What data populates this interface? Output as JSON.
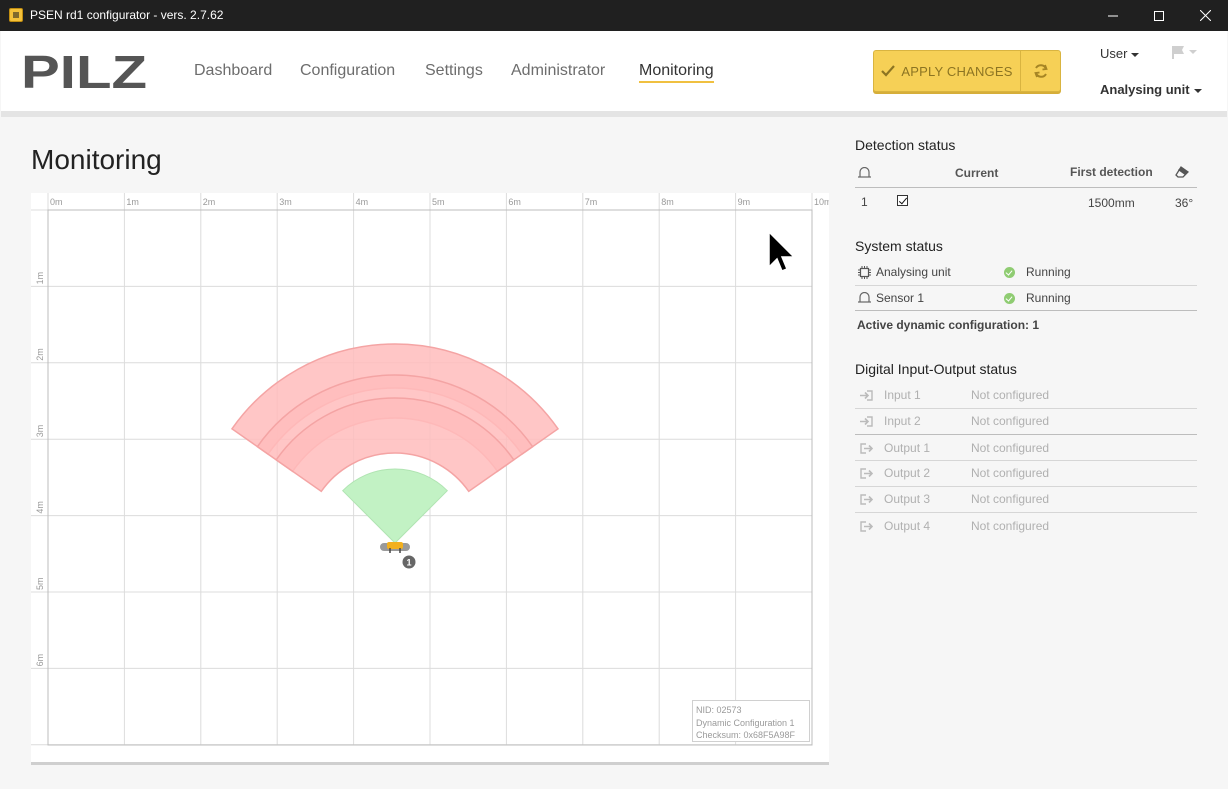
{
  "window": {
    "title": "PSEN rd1 configurator - vers. 2.7.62"
  },
  "header": {
    "logo": "PILZ",
    "nav": [
      {
        "label": "Dashboard"
      },
      {
        "label": "Configuration"
      },
      {
        "label": "Settings"
      },
      {
        "label": "Administrator"
      },
      {
        "label": "Monitoring",
        "active": true
      }
    ],
    "apply_label": "APPLY CHANGES",
    "user_label": "User",
    "unit_label": "Analysing unit"
  },
  "main": {
    "title": "Monitoring",
    "map": {
      "x_ticks": [
        "0m",
        "1m",
        "2m",
        "3m",
        "4m",
        "5m",
        "6m",
        "7m",
        "8m",
        "9m",
        "10m"
      ],
      "y_ticks": [
        "1m",
        "2m",
        "3m",
        "4m",
        "5m",
        "6m"
      ],
      "sensor_badge": "1",
      "info": {
        "nid": "NID: 02573",
        "config": "Dynamic Configuration 1",
        "checksum": "Checksum: 0x68F5A98F"
      }
    }
  },
  "detection": {
    "title": "Detection status",
    "col_current": "Current",
    "col_first": "First detection",
    "rows": [
      {
        "id": "1",
        "current": true,
        "first": "1500mm",
        "angle": "36°"
      }
    ]
  },
  "system": {
    "title": "System status",
    "items": [
      {
        "label": "Analysing unit",
        "status": "Running"
      },
      {
        "label": "Sensor 1",
        "status": "Running"
      }
    ],
    "active_config": "Active dynamic configuration: 1"
  },
  "io": {
    "title": "Digital Input-Output status",
    "items": [
      {
        "label": "Input 1",
        "status": "Not configured",
        "kind": "input"
      },
      {
        "label": "Input 2",
        "status": "Not configured",
        "kind": "input"
      },
      {
        "label": "Output 1",
        "status": "Not configured",
        "kind": "output"
      },
      {
        "label": "Output 2",
        "status": "Not configured",
        "kind": "output"
      },
      {
        "label": "Output 3",
        "status": "Not configured",
        "kind": "output"
      },
      {
        "label": "Output 4",
        "status": "Not configured",
        "kind": "output"
      }
    ]
  },
  "colors": {
    "accent": "#f6d056",
    "warning_zone": "#ffbcbc",
    "detection_zone": "#c2f2c4",
    "ok": "#8fcc72"
  }
}
